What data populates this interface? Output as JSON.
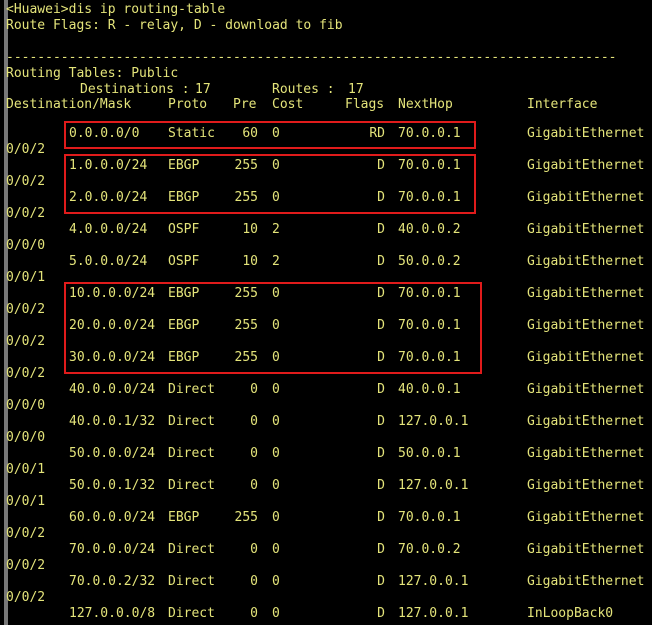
{
  "terminal": {
    "prompt_line": "<Huawei>dis ip routing-table",
    "route_flags_line": "Route Flags: R - relay, D - download to fib",
    "separator": "------------------------------------------------------------------------------",
    "routing_tables_line": "Routing Tables: Public",
    "counts_line": "         Destinations : 17        Routes : 17",
    "destinations_label": "Destinations :",
    "destinations_value": "17",
    "routes_label": "Routes :",
    "routes_value": "17",
    "colors": {
      "background": "#000000",
      "text": "#e4e47a",
      "highlight_box": "#e01b1b",
      "scrollbar": "#8d8d8d"
    }
  },
  "table": {
    "headers": [
      "Destination/Mask",
      "Proto",
      "Pre",
      "Cost",
      "Flags",
      "NextHop",
      "Interface"
    ],
    "header_line": "Destination/Mask    Proto   Pre  Cost      Flags NextHop         Interface",
    "rows": [
      {
        "destination": "0.0.0.0/0",
        "proto": "Static",
        "pre": "60",
        "cost": "0",
        "flags": "RD",
        "nexthop": "70.0.0.1",
        "interface": "GigabitEthernet",
        "interface_wrap": "0/0/2",
        "highlighted": true
      },
      {
        "destination": "1.0.0.0/24",
        "proto": "EBGP",
        "pre": "255",
        "cost": "0",
        "flags": "D",
        "nexthop": "70.0.0.1",
        "interface": "GigabitEthernet",
        "interface_wrap": "0/0/2",
        "highlighted": true
      },
      {
        "destination": "2.0.0.0/24",
        "proto": "EBGP",
        "pre": "255",
        "cost": "0",
        "flags": "D",
        "nexthop": "70.0.0.1",
        "interface": "GigabitEthernet",
        "interface_wrap": "0/0/2",
        "highlighted": true
      },
      {
        "destination": "4.0.0.0/24",
        "proto": "OSPF",
        "pre": "10",
        "cost": "2",
        "flags": "D",
        "nexthop": "40.0.0.2",
        "interface": "GigabitEthernet",
        "interface_wrap": "0/0/0",
        "highlighted": false
      },
      {
        "destination": "5.0.0.0/24",
        "proto": "OSPF",
        "pre": "10",
        "cost": "2",
        "flags": "D",
        "nexthop": "50.0.0.2",
        "interface": "GigabitEthernet",
        "interface_wrap": "0/0/1",
        "highlighted": false
      },
      {
        "destination": "10.0.0.0/24",
        "proto": "EBGP",
        "pre": "255",
        "cost": "0",
        "flags": "D",
        "nexthop": "70.0.0.1",
        "interface": "GigabitEthernet",
        "interface_wrap": "0/0/2",
        "highlighted": true
      },
      {
        "destination": "20.0.0.0/24",
        "proto": "EBGP",
        "pre": "255",
        "cost": "0",
        "flags": "D",
        "nexthop": "70.0.0.1",
        "interface": "GigabitEthernet",
        "interface_wrap": "0/0/2",
        "highlighted": true
      },
      {
        "destination": "30.0.0.0/24",
        "proto": "EBGP",
        "pre": "255",
        "cost": "0",
        "flags": "D",
        "nexthop": "70.0.0.1",
        "interface": "GigabitEthernet",
        "interface_wrap": "0/0/2",
        "highlighted": true
      },
      {
        "destination": "40.0.0.0/24",
        "proto": "Direct",
        "pre": "0",
        "cost": "0",
        "flags": "D",
        "nexthop": "40.0.0.1",
        "interface": "GigabitEthernet",
        "interface_wrap": "0/0/0",
        "highlighted": false
      },
      {
        "destination": "40.0.0.1/32",
        "proto": "Direct",
        "pre": "0",
        "cost": "0",
        "flags": "D",
        "nexthop": "127.0.0.1",
        "interface": "GigabitEthernet",
        "interface_wrap": "0/0/0",
        "highlighted": false
      },
      {
        "destination": "50.0.0.0/24",
        "proto": "Direct",
        "pre": "0",
        "cost": "0",
        "flags": "D",
        "nexthop": "50.0.0.1",
        "interface": "GigabitEthernet",
        "interface_wrap": "0/0/1",
        "highlighted": false
      },
      {
        "destination": "50.0.0.1/32",
        "proto": "Direct",
        "pre": "0",
        "cost": "0",
        "flags": "D",
        "nexthop": "127.0.0.1",
        "interface": "GigabitEthernet",
        "interface_wrap": "0/0/1",
        "highlighted": false
      },
      {
        "destination": "60.0.0.0/24",
        "proto": "EBGP",
        "pre": "255",
        "cost": "0",
        "flags": "D",
        "nexthop": "70.0.0.1",
        "interface": "GigabitEthernet",
        "interface_wrap": "0/0/2",
        "highlighted": false
      },
      {
        "destination": "70.0.0.0/24",
        "proto": "Direct",
        "pre": "0",
        "cost": "0",
        "flags": "D",
        "nexthop": "70.0.0.2",
        "interface": "GigabitEthernet",
        "interface_wrap": "0/0/2",
        "highlighted": false
      },
      {
        "destination": "70.0.0.2/32",
        "proto": "Direct",
        "pre": "0",
        "cost": "0",
        "flags": "D",
        "nexthop": "127.0.0.1",
        "interface": "GigabitEthernet",
        "interface_wrap": "0/0/2",
        "highlighted": false
      },
      {
        "destination": "127.0.0.0/8",
        "proto": "Direct",
        "pre": "0",
        "cost": "0",
        "flags": "D",
        "nexthop": "127.0.0.1",
        "interface": "InLoopBack0",
        "interface_wrap": "",
        "highlighted": false
      }
    ]
  },
  "highlight_boxes": [
    {
      "label": "default-route-highlight",
      "row_start": 0,
      "row_count": 1
    },
    {
      "label": "ebgp-routes-highlight-a",
      "row_start": 1,
      "row_count": 2
    },
    {
      "label": "ebgp-routes-highlight-b",
      "row_start": 5,
      "row_count": 3
    }
  ]
}
